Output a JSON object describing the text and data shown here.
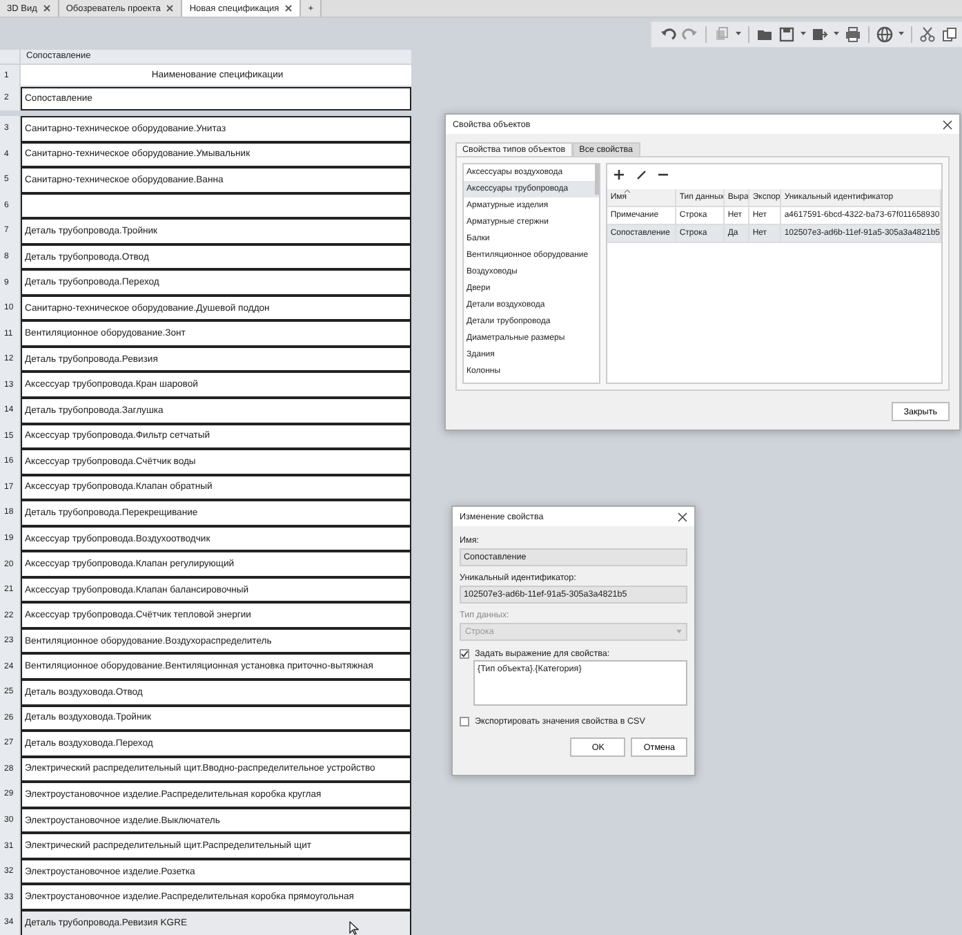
{
  "tabs": [
    {
      "label": "3D Вид",
      "selected": false
    },
    {
      "label": "Обозреватель проекта",
      "selected": false
    },
    {
      "label": "Новая спецификация",
      "selected": true
    }
  ],
  "new_tab_button": "+",
  "sheet": {
    "column_header": "Сопоставление",
    "rows": [
      {
        "number": "1",
        "kind": "title",
        "text": "Наименование спецификации",
        "selected": false
      },
      {
        "number": "2",
        "kind": "group",
        "text": "Сопоставление",
        "selected": false
      },
      {
        "number": "3",
        "kind": "item",
        "text": "Санитарно-техническое оборудование.Унитаз",
        "selected": false
      },
      {
        "number": "4",
        "kind": "item",
        "text": "Санитарно-техническое оборудование.Умывальник",
        "selected": false
      },
      {
        "number": "5",
        "kind": "item",
        "text": "Санитарно-техническое оборудование.Ванна",
        "selected": false
      },
      {
        "number": "6",
        "kind": "item",
        "selected": false
      },
      {
        "number": "7",
        "kind": "item",
        "text": "Деталь трубопровода.Тройник",
        "selected": false
      },
      {
        "number": "8",
        "kind": "item",
        "text": "Деталь трубопровода.Отвод",
        "selected": false
      },
      {
        "number": "9",
        "kind": "item",
        "text": "Деталь трубопровода.Переход",
        "selected": false
      },
      {
        "number": "10",
        "kind": "item",
        "text": "Санитарно-техническое оборудование.Душевой поддон",
        "selected": false
      },
      {
        "number": "11",
        "kind": "item",
        "text": "Вентиляционное оборудование.Зонт",
        "selected": false
      },
      {
        "number": "12",
        "kind": "item",
        "text": "Деталь трубопровода.Ревизия",
        "selected": false
      },
      {
        "number": "13",
        "kind": "item",
        "text": "Аксессуар трубопровода.Кран шаровой",
        "selected": false
      },
      {
        "number": "14",
        "kind": "item",
        "text": "Деталь трубопровода.Заглушка",
        "selected": false
      },
      {
        "number": "15",
        "kind": "item",
        "text": "Аксессуар трубопровода.Фильтр сетчатый",
        "selected": false
      },
      {
        "number": "16",
        "kind": "item",
        "text": "Аксессуар трубопровода.Счётчик воды",
        "selected": false
      },
      {
        "number": "17",
        "kind": "item",
        "text": "Аксессуар трубопровода.Клапан обратный",
        "selected": false
      },
      {
        "number": "18",
        "kind": "item",
        "text": "Деталь трубопровода.Перекрещивание",
        "selected": false
      },
      {
        "number": "19",
        "kind": "item",
        "text": "Аксессуар трубопровода.Воздухоотводчик",
        "selected": false
      },
      {
        "number": "20",
        "kind": "item",
        "text": "Аксессуар трубопровода.Клапан регулирующий",
        "selected": false
      },
      {
        "number": "21",
        "kind": "item",
        "text": "Аксессуар трубопровода.Клапан балансировочный",
        "selected": false
      },
      {
        "number": "22",
        "kind": "item",
        "text": "Аксессуар трубопровода.Счётчик тепловой энергии",
        "selected": false
      },
      {
        "number": "23",
        "kind": "item",
        "text": "Вентиляционное оборудование.Воздухораспределитель",
        "selected": false
      },
      {
        "number": "24",
        "kind": "item",
        "text": "Вентиляционное оборудование.Вентиляционная установка приточно-вытяжная",
        "selected": false
      },
      {
        "number": "25",
        "kind": "item",
        "text": "Деталь воздуховода.Отвод",
        "selected": false
      },
      {
        "number": "26",
        "kind": "item",
        "text": "Деталь воздуховода.Тройник",
        "selected": false
      },
      {
        "number": "27",
        "kind": "item",
        "text": "Деталь воздуховода.Переход",
        "selected": false
      },
      {
        "number": "28",
        "kind": "item",
        "text": "Электрический распределительный щит.Вводно-распределительное устройство",
        "selected": false
      },
      {
        "number": "29",
        "kind": "item",
        "text": "Электроустановочное изделие.Распределительная коробка круглая",
        "selected": false
      },
      {
        "number": "30",
        "kind": "item",
        "text": "Электроустановочное изделие.Выключатель",
        "selected": false
      },
      {
        "number": "31",
        "kind": "item",
        "text": "Электрический распределительный щит.Распределительный щит",
        "selected": false
      },
      {
        "number": "32",
        "kind": "item",
        "text": "Электроустановочное изделие.Розетка",
        "selected": false
      },
      {
        "number": "33",
        "kind": "item",
        "text": "Электроустановочное изделие.Распределительная коробка прямоугольная",
        "selected": false
      },
      {
        "number": "34",
        "kind": "item",
        "text": "Деталь трубопровода.Ревизия KGRE",
        "selected": true
      }
    ]
  },
  "properties_dialog": {
    "title": "Свойства объектов",
    "tabs": [
      {
        "label": "Свойства типов объектов",
        "selected": true
      },
      {
        "label": "Все свойства",
        "selected": false
      }
    ],
    "categories": [
      {
        "label": "Аксессуары воздуховода",
        "selected": false
      },
      {
        "label": "Аксессуары трубопровода",
        "selected": true
      },
      {
        "label": "Арматурные изделия",
        "selected": false
      },
      {
        "label": "Арматурные стержни",
        "selected": false
      },
      {
        "label": "Балки",
        "selected": false
      },
      {
        "label": "Вентиляционное оборудование",
        "selected": false
      },
      {
        "label": "Воздуховоды",
        "selected": false
      },
      {
        "label": "Двери",
        "selected": false
      },
      {
        "label": "Детали воздуховода",
        "selected": false
      },
      {
        "label": "Детали трубопровода",
        "selected": false
      },
      {
        "label": "Диаметральные размеры",
        "selected": false
      },
      {
        "label": "Здания",
        "selected": false
      },
      {
        "label": "Колонны",
        "selected": false
      }
    ],
    "columns": [
      "Имя",
      "Тип данных",
      "Выра",
      "Экспор",
      "Уникальный идентификатор"
    ],
    "rows": [
      {
        "cells": [
          "Примечание",
          "Строка",
          "Нет",
          "Нет",
          "a4617591-6bcd-4322-ba73-67f011658930"
        ],
        "selected": false
      },
      {
        "cells": [
          "Сопоставление",
          "Строка",
          "Да",
          "Нет",
          "102507e3-ad6b-11ef-91a5-305a3a4821b5"
        ],
        "selected": true
      }
    ],
    "close_button": "Закрыть"
  },
  "edit_dialog": {
    "title": "Изменение свойства",
    "fields": [
      {
        "label": "Имя:",
        "value": "Сопоставление"
      },
      {
        "label": "Уникальный идентификатор:",
        "value": "102507e3-ad6b-11ef-91a5-305a3a4821b5"
      }
    ],
    "data_type": {
      "label": "Тип данных:",
      "value": "Строка",
      "disabled": true
    },
    "expression": {
      "label": "Задать выражение для свойства:",
      "checked": true,
      "value": "{Тип объекта}.{Категория}"
    },
    "export": {
      "label": "Экспортировать значения свойства в CSV",
      "checked": false
    },
    "buttons": [
      "OK",
      "Отмена"
    ]
  }
}
